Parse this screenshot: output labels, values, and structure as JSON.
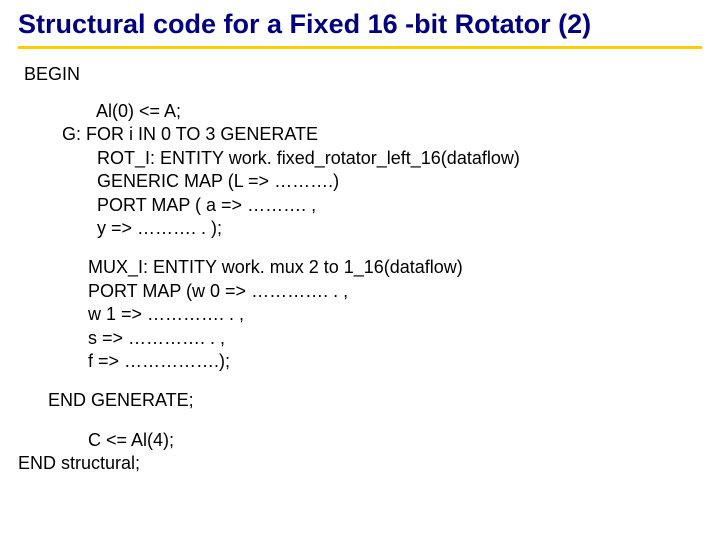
{
  "title": "Structural code for a Fixed 16 -bit Rotator (2)",
  "begin": "BEGIN",
  "block1": {
    "l1": "       Al(0) <= A;",
    "l2": "G: FOR i IN 0 TO 3 GENERATE",
    "l3": "       ROT_I: ENTITY work. fixed_rotator_left_16(dataflow)",
    "l4": "       GENERIC MAP (L => ……….)",
    "l5": "       PORT MAP ( a => ………. ,",
    "l6": "       y => ………. . );"
  },
  "block2": {
    "l1": "MUX_I: ENTITY work. mux 2 to 1_16(dataflow)",
    "l2": "PORT MAP (w 0 => …………. . ,",
    "l3": "w 1 => …………. . ,",
    "l4": "s => …………. . ,",
    "l5": "f => …………….);"
  },
  "endgen": "END GENERATE;",
  "tail": {
    "l1": "C <= Al(4);",
    "l2": "END structural;"
  }
}
